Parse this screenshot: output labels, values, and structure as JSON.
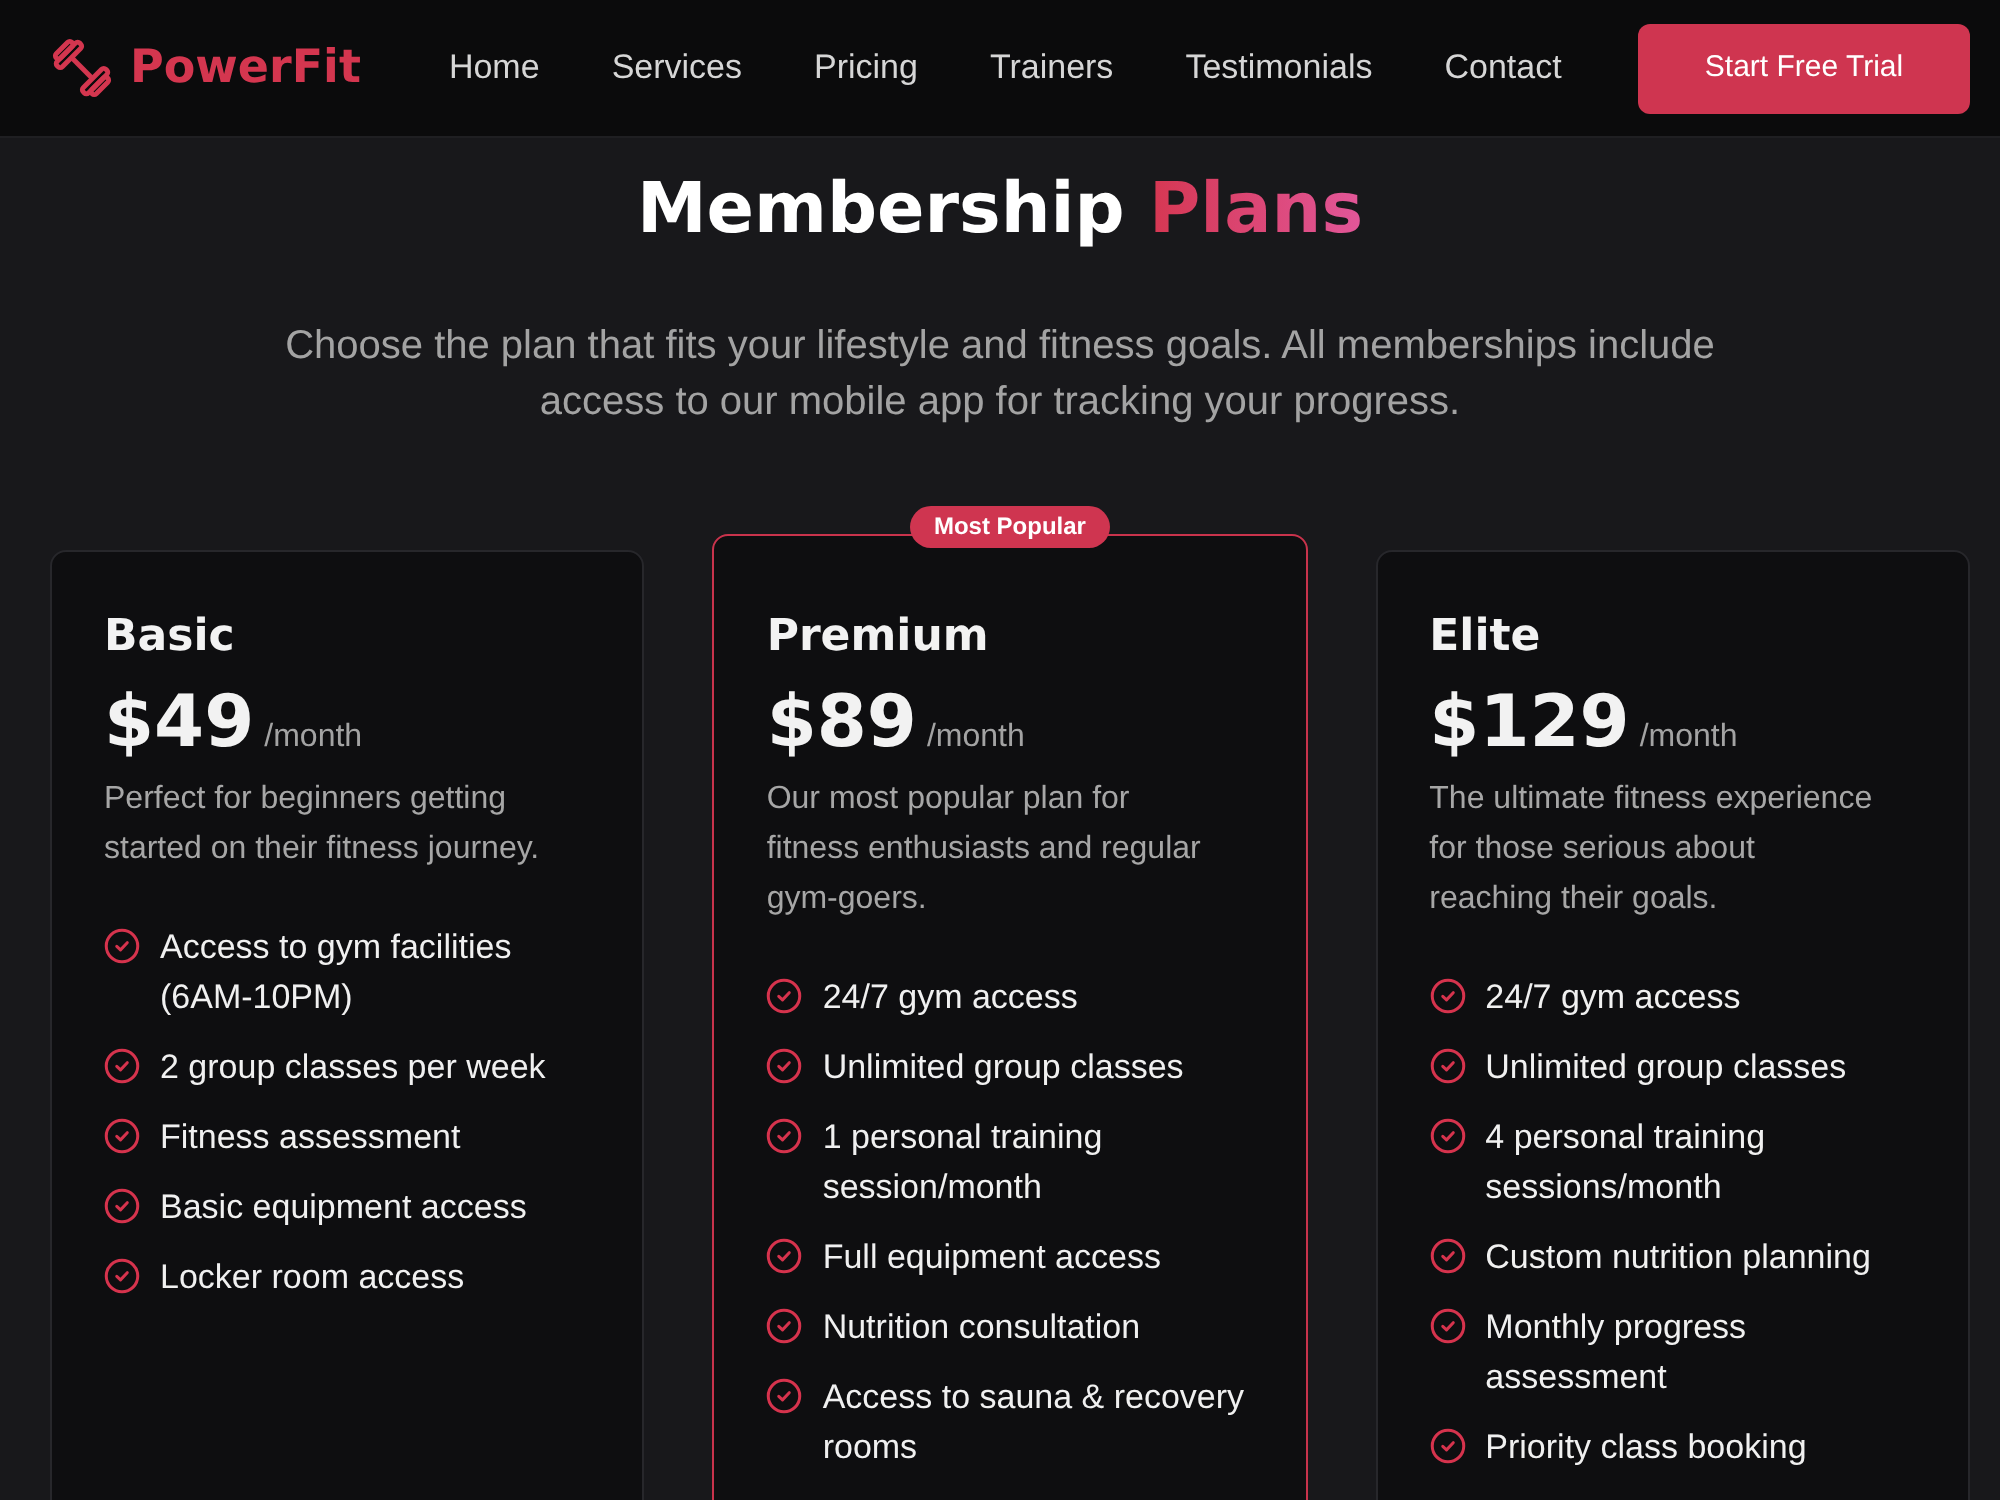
{
  "navbar": {
    "brand": "PowerFit",
    "links": [
      {
        "label": "Home"
      },
      {
        "label": "Services"
      },
      {
        "label": "Pricing"
      },
      {
        "label": "Trainers"
      },
      {
        "label": "Testimonials"
      },
      {
        "label": "Contact"
      }
    ],
    "cta": "Start Free Trial"
  },
  "heading": {
    "text": "Membership",
    "highlight": "Plans"
  },
  "intro": "Choose the plan that fits your lifestyle and fitness goals. All memberships include access to our mobile app for tracking your progress.",
  "plans": [
    {
      "name": "Basic",
      "price": "$49",
      "period": "/month",
      "description": "Perfect for beginners getting started on their fitness journey.",
      "featured": false,
      "features": [
        "Access to gym facilities (6AM-10PM)",
        "2 group classes per week",
        "Fitness assessment",
        "Basic equipment access",
        "Locker room access"
      ]
    },
    {
      "name": "Premium",
      "badge": "Most Popular",
      "price": "$89",
      "period": "/month",
      "description": "Our most popular plan for fitness enthusiasts and regular gym-goers.",
      "featured": true,
      "features": [
        "24/7 gym access",
        "Unlimited group classes",
        "1 personal training session/month",
        "Full equipment access",
        "Nutrition consultation",
        "Access to sauna & recovery rooms"
      ]
    },
    {
      "name": "Elite",
      "price": "$129",
      "period": "/month",
      "description": "The ultimate fitness experience for those serious about reaching their goals.",
      "featured": false,
      "features": [
        "24/7 gym access",
        "Unlimited group classes",
        "4 personal training sessions/month",
        "Custom nutrition planning",
        "Monthly progress assessment",
        "Priority class booking"
      ]
    }
  ]
}
